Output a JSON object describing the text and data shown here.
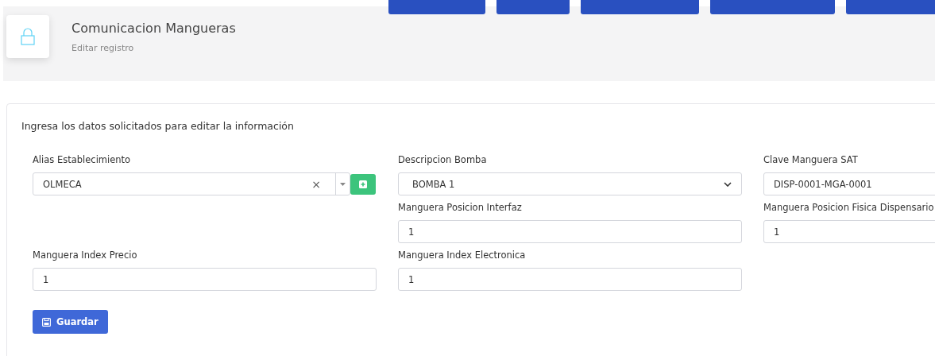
{
  "header": {
    "title": "Comunicacion Mangueras",
    "subtitle": "Editar registro"
  },
  "form": {
    "intro": "Ingresa los datos solicitados para editar la información",
    "rows": [
      [
        {
          "kind": "combo",
          "label": "Alias Establecimiento",
          "value": "OLMECA",
          "clear": "×"
        },
        {
          "kind": "select",
          "label": "Descripcion Bomba",
          "value": "BOMBA 1"
        },
        {
          "kind": "text",
          "label": "Clave Manguera SAT",
          "value": "DISP-0001-MGA-0001"
        }
      ],
      [
        null,
        {
          "kind": "text",
          "label": "Manguera Posicion Interfaz",
          "value": "1"
        },
        {
          "kind": "text",
          "label": "Manguera Posicion Fisica Dispensario",
          "value": "1"
        }
      ],
      [
        {
          "kind": "text",
          "label": "Manguera Index Precio",
          "value": "1"
        },
        {
          "kind": "text",
          "label": "Manguera Index Electronica",
          "value": "1"
        },
        null
      ]
    ],
    "save_button": "Guardar"
  }
}
